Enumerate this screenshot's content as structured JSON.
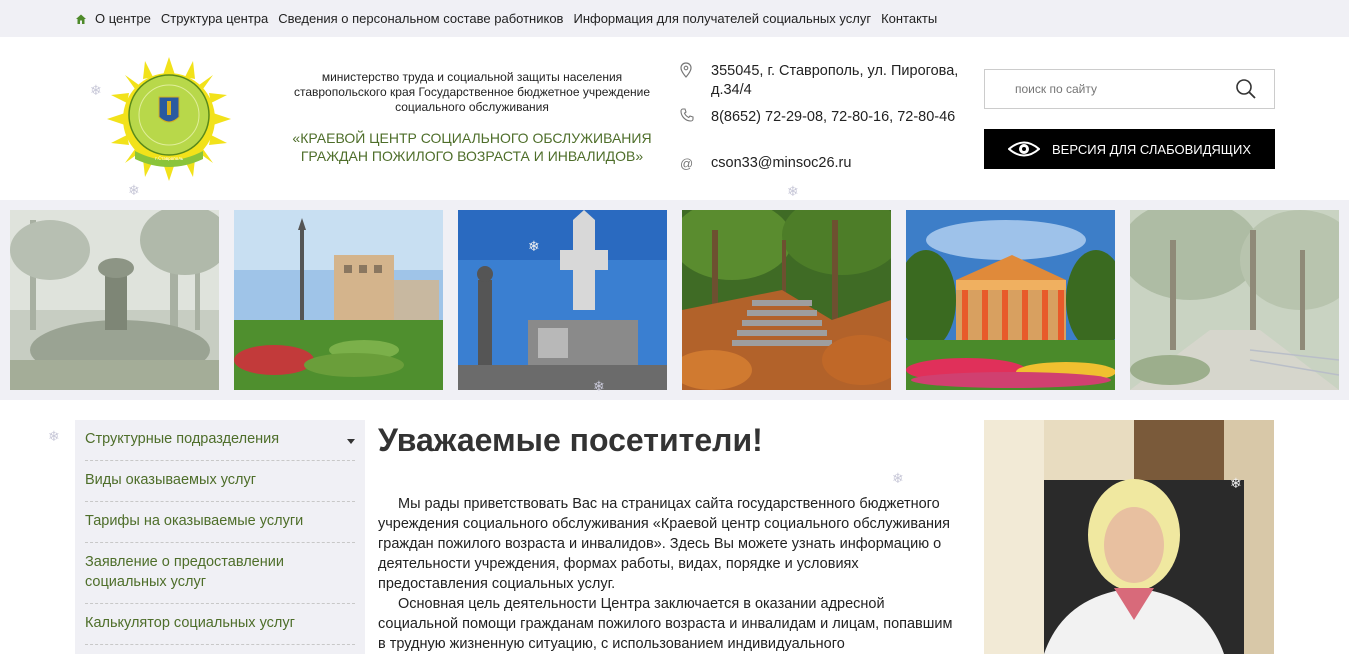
{
  "topnav": {
    "items": [
      "О центре",
      "Структура центра",
      "Сведения о персональном составе работников",
      "Информация для получателей социальных услуг",
      "Контакты"
    ]
  },
  "header": {
    "ministry_line1": "министерство труда и социальной защиты населения",
    "ministry_line2": "ставропольского края Государственное бюджетное учреждение",
    "ministry_line3": "социального обслуживания",
    "center_line1": "«КРАЕВОЙ ЦЕНТР СОЦИАЛЬНОГО ОБСЛУЖИВАНИЯ",
    "center_line2": "ГРАЖДАН ПОЖИЛОГО ВОЗРАСТА И ИНВАЛИДОВ»",
    "address": "355045, г. Ставрополь, ул. Пирогова, д.34/4",
    "phone": "8(8652) 72-29-08, 72-80-16, 72-80-46",
    "email": "cson33@minsoc26.ru",
    "email_symbol": "@"
  },
  "search": {
    "placeholder": "поиск по сайту"
  },
  "vision_button": {
    "label": "ВЕРСИЯ ДЛЯ СЛАБОВИДЯЩИХ"
  },
  "sidebar": {
    "items": [
      "Структурные подразделения",
      "Виды оказываемых услуг",
      "Тарифы на оказываемые услуги",
      "Заявление о предоставлении социальных услуг",
      "Калькулятор социальных услуг"
    ]
  },
  "main": {
    "title": "Уважаемые посетители!",
    "para1": "Мы рады приветствовать Вас на страницах сайта государственного бюджетного учреждения социального обслуживания «Краевой центр социального обслуживания граждан пожилого возраста и инвалидов». Здесь Вы можете узнать информацию о деятельности учреждения, формах работы, видах, порядке и условиях предоставления социальных услуг.",
    "para2": "Основная цель деятельности Центра заключается в оказании адресной социальной помощи гражданам пожилого возраста и инвалидам и лицам, попавшим в трудную жизненную ситуацию, с использованием индивидуального"
  },
  "colors": {
    "accent_green": "#4e6e2a",
    "nav_bg": "#f0f0f5",
    "button_bg": "#000000"
  },
  "icons": [
    "home-icon",
    "location-icon",
    "phone-icon",
    "search-icon",
    "eye-icon",
    "chevron-down-icon"
  ]
}
